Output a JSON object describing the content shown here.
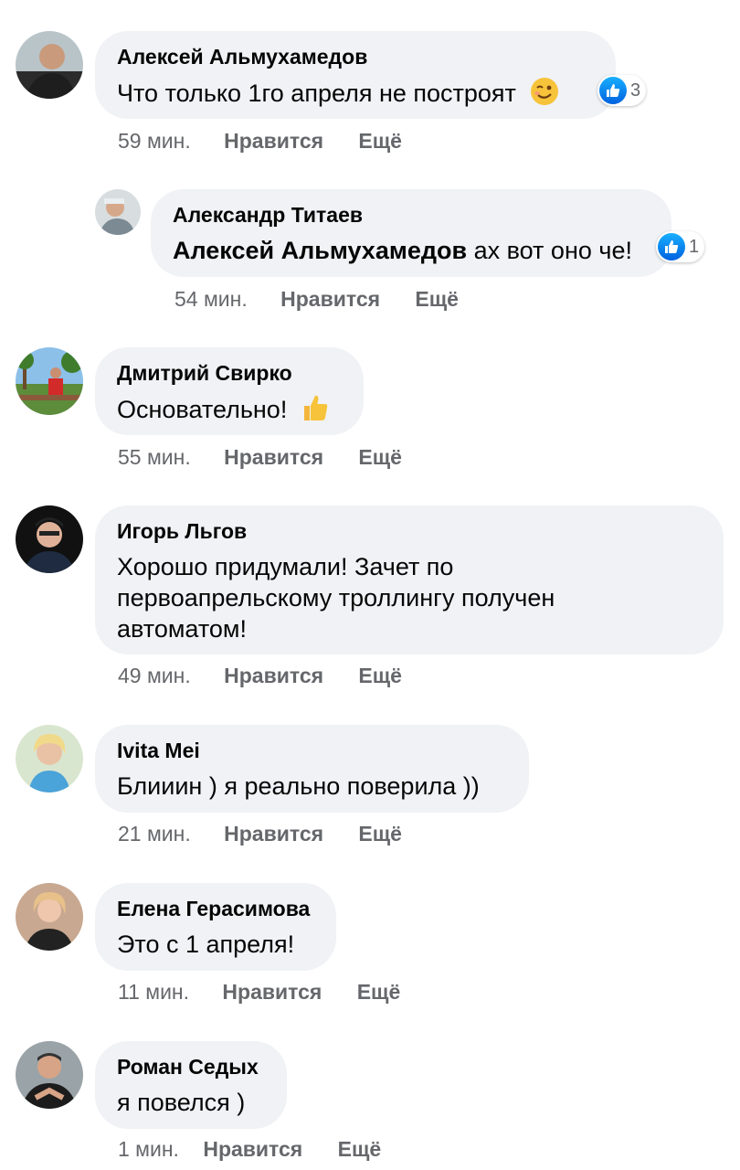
{
  "comments": [
    {
      "author": "Алексей Альмухамедов",
      "text": "Что только 1го апреля не построят",
      "emoji": "wink-emoji",
      "reactions": "3",
      "time": "59 мин.",
      "like": "Нравится",
      "more": "Ещё"
    },
    {
      "author": "Александр Титаев",
      "mention": "Алексей Альмухамедов",
      "text": "ах вот оно че!",
      "reactions": "1",
      "time": "54 мин.",
      "like": "Нравится",
      "more": "Ещё"
    },
    {
      "author": "Дмитрий Свирко",
      "text": "Основательно!",
      "emoji": "thumbs-up-emoji",
      "time": "55 мин.",
      "like": "Нравится",
      "more": "Ещё"
    },
    {
      "author": "Игорь Льгов",
      "text_lines": [
        "Хорошо придумали! Зачет по",
        "первоапрельскому троллингу получен",
        "автоматом!"
      ],
      "time": "49 мин.",
      "like": "Нравится",
      "more": "Ещё"
    },
    {
      "author": "Ivita Mei",
      "text": "Блииин ) я реально поверила ))",
      "time": "21 мин.",
      "like": "Нравится",
      "more": "Ещё"
    },
    {
      "author": "Елена Герасимова",
      "text": "Это с 1 апреля!",
      "time": "11 мин.",
      "like": "Нравится",
      "more": "Ещё"
    },
    {
      "author": "Роман Седых",
      "text": "я повелся )",
      "time": "1 мин.",
      "like": "Нравится",
      "more": "Ещё"
    }
  ],
  "colors": {
    "bubble": "#f0f2f5",
    "meta": "#65676b",
    "like_blue": "#1877f2"
  }
}
